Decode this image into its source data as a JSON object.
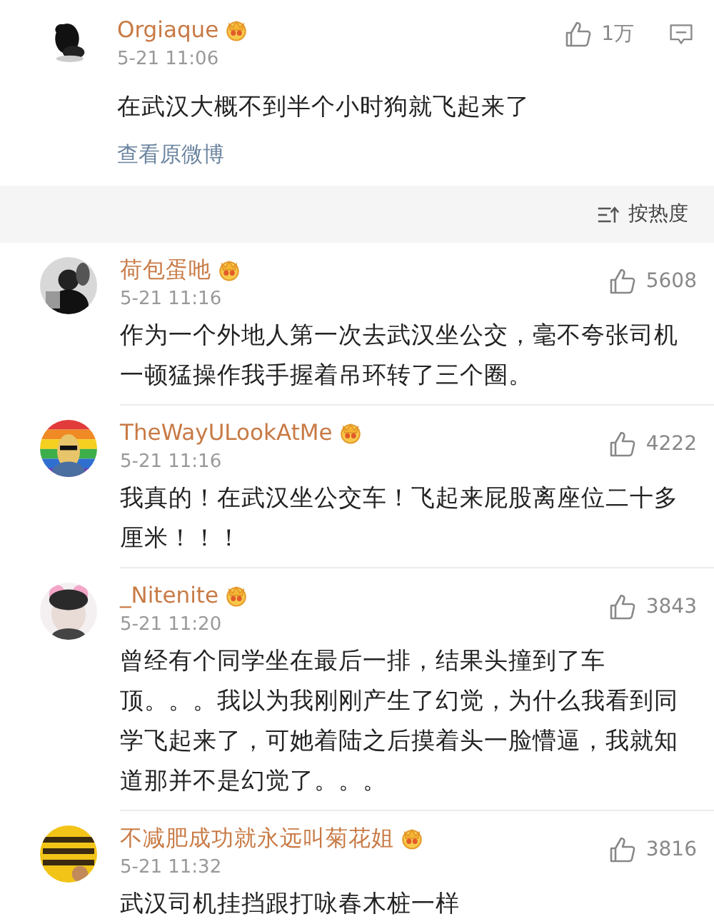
{
  "post": {
    "author": "Orgiaque",
    "time": "5-21 11:06",
    "text": "在武汉大概不到半个小时狗就飞起来了",
    "link": "查看原微博",
    "likes": "1万"
  },
  "sort": {
    "label": "按热度"
  },
  "comments": [
    {
      "author": "荷包蛋吔",
      "time": "5-21 11:16",
      "text": "作为一个外地人第一次去武汉坐公交，毫不夸张司机一顿猛操作我手握着吊环转了三个圈。",
      "likes": "5608"
    },
    {
      "author": "TheWayULookAtMe",
      "time": "5-21 11:16",
      "text": "我真的！在武汉坐公交车！飞起来屁股离座位二十多厘米！！！",
      "likes": "4222"
    },
    {
      "author": "_Nitenite",
      "time": "5-21 11:20",
      "text": "曾经有个同学坐在最后一排，结果头撞到了车顶。。。我以为我刚刚产生了幻觉，为什么我看到同学飞起来了，可她着陆之后摸着头一脸懵逼，我就知道那并不是幻觉了。。。",
      "likes": "3843"
    },
    {
      "author": "不减肥成功就永远叫菊花姐",
      "time": "5-21 11:32",
      "text": "武汉司机挂挡跟打咏春木桩一样",
      "likes": "3816"
    }
  ]
}
